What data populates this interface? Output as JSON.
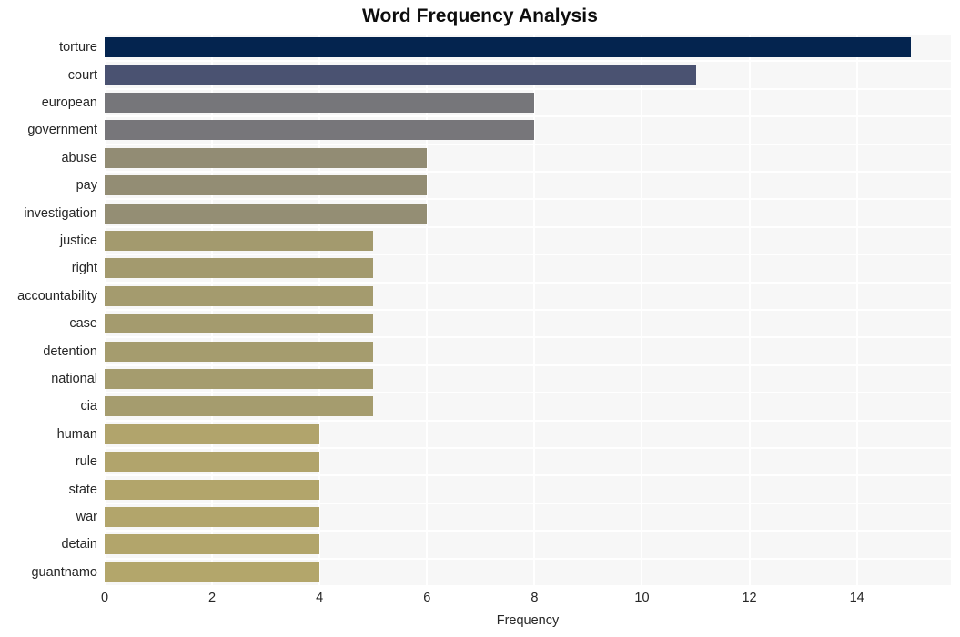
{
  "chart_data": {
    "type": "bar",
    "orientation": "horizontal",
    "title": "Word Frequency Analysis",
    "xlabel": "Frequency",
    "ylabel": "",
    "categories": [
      "torture",
      "court",
      "european",
      "government",
      "abuse",
      "pay",
      "investigation",
      "justice",
      "right",
      "accountability",
      "case",
      "detention",
      "national",
      "cia",
      "human",
      "rule",
      "state",
      "war",
      "detain",
      "guantnamo"
    ],
    "values": [
      15,
      11,
      8,
      8,
      6,
      6,
      6,
      5,
      5,
      5,
      5,
      5,
      5,
      5,
      4,
      4,
      4,
      4,
      4,
      4
    ],
    "bar_colors": [
      "#04244f",
      "#4a5271",
      "#76767a",
      "#77767a",
      "#928c74",
      "#938d74",
      "#948e74",
      "#a39a6e",
      "#a39a6e",
      "#a49b6e",
      "#a49b6e",
      "#a59c6e",
      "#a59c6e",
      "#a59c6e",
      "#b1a46c",
      "#b1a46c",
      "#b2a56b",
      "#b2a56b",
      "#b2a56b",
      "#b3a66b"
    ],
    "xlim": [
      0,
      15.75
    ],
    "xticks": [
      0,
      2,
      4,
      6,
      8,
      10,
      12,
      14
    ],
    "xtick_labels": [
      "0",
      "2",
      "4",
      "6",
      "8",
      "10",
      "12",
      "14"
    ],
    "grid": true,
    "grid_color": "#ffffff",
    "plot_background": "#f7f7f7",
    "figure_background": "#ffffff",
    "legend": null
  }
}
